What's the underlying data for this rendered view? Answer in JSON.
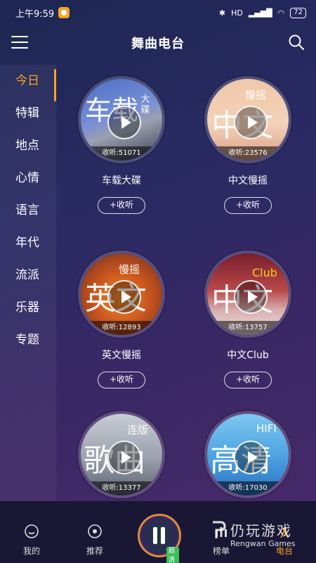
{
  "status": {
    "time": "上午9:59",
    "battery": "72",
    "network": "HD"
  },
  "header": {
    "title": "舞曲电台"
  },
  "sidebar": {
    "items": [
      {
        "label": "今日",
        "active": true
      },
      {
        "label": "特辑"
      },
      {
        "label": "地点"
      },
      {
        "label": "心情"
      },
      {
        "label": "语言"
      },
      {
        "label": "年代"
      },
      {
        "label": "流派"
      },
      {
        "label": "乐器"
      },
      {
        "label": "专题"
      }
    ]
  },
  "cards": [
    {
      "title": "车载大碟",
      "count": "收听:51071",
      "art_big": "车载",
      "art_small": "大碟",
      "button": "+收听"
    },
    {
      "title": "中文慢摇",
      "count": "收听:23576",
      "art_big": "中文",
      "art_small": "慢摇",
      "button": "+收听"
    },
    {
      "title": "英文慢摇",
      "count": "收听:12893",
      "art_big": "英文",
      "art_small": "慢摇",
      "button": "+收听"
    },
    {
      "title": "中文Club",
      "count": "收听:13757",
      "art_big": "中文",
      "art_small": "Club",
      "button": "+收听"
    },
    {
      "title": "",
      "count": "收听:13377",
      "art_big": "歌曲",
      "art_small": "连版",
      "button": ""
    },
    {
      "title": "",
      "count": "收听:17030",
      "art_big": "高清",
      "art_small": "HIFI",
      "button": ""
    }
  ],
  "bottom_nav": {
    "mine": "我的",
    "recommend": "推荐",
    "player_badge": "超清",
    "charts": "榜单",
    "radio": "电台"
  },
  "watermark": {
    "cn": "仍玩游戏",
    "en": "Rengwan Games"
  },
  "colors": {
    "accent": "#f5a623"
  }
}
